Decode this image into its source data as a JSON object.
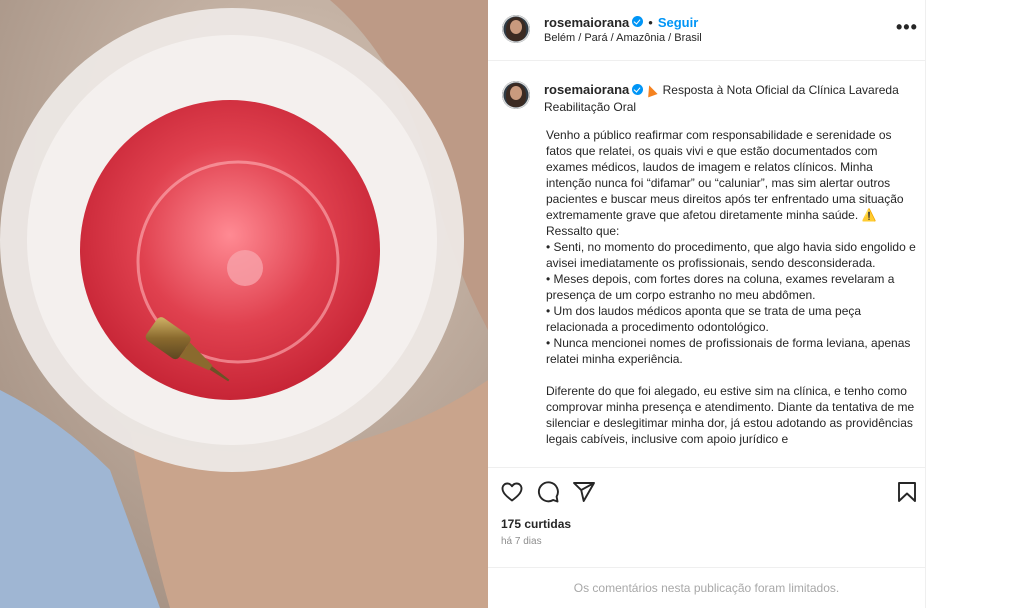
{
  "post": {
    "username": "rosemaiorana",
    "follow_label": "Seguir",
    "dot": "•",
    "location": "Belém / Pará / Amazônia / Brasil",
    "more_label": "•••"
  },
  "caption": {
    "username": "rosemaiorana",
    "headline": "Resposta à Nota Oficial da Clínica Lavareda Reabilitação Oral",
    "body": "Venho a público reafirmar com responsabilidade e serenidade os fatos que relatei, os quais vivi e que estão documentados com exames médicos, laudos de imagem e relatos clínicos. Minha intenção nunca foi “difamar” ou “caluniar”, mas sim alertar outros pacientes e buscar meus direitos após ter enfrentado uma situação extremamente grave que afetou diretamente minha saúde. ⚠️\nRessalto que:\n• Senti, no momento do procedimento, que algo havia sido engolido e avisei imediatamente os profissionais, sendo desconsiderada.\n• Meses depois, com fortes dores na coluna, exames revelaram a presença de um corpo estranho no meu abdômen.\n• Um dos laudos médicos aponta que se trata de uma peça relacionada a procedimento odontológico.\n• Nunca mencionei nomes de profissionais de forma leviana, apenas relatei minha experiência.\n\nDiferente do que foi alegado, eu estive sim na clínica, e tenho como comprovar minha presença e atendimento. Diante da tentativa de me silenciar e deslegitimar minha dor, já estou adotando as providências legais cabíveis, inclusive com apoio jurídico e"
  },
  "actions": {
    "like_icon": "heart-icon",
    "comment_icon": "comment-icon",
    "share_icon": "share-icon",
    "save_icon": "bookmark-icon"
  },
  "stats": {
    "likes": "175 curtidas",
    "time": "há 7 dias"
  },
  "comments_limited": "Os comentários nesta publicação foram limitados.",
  "colors": {
    "accent": "#0095f6",
    "liquid": "#d9303f",
    "border": "#efefef"
  }
}
